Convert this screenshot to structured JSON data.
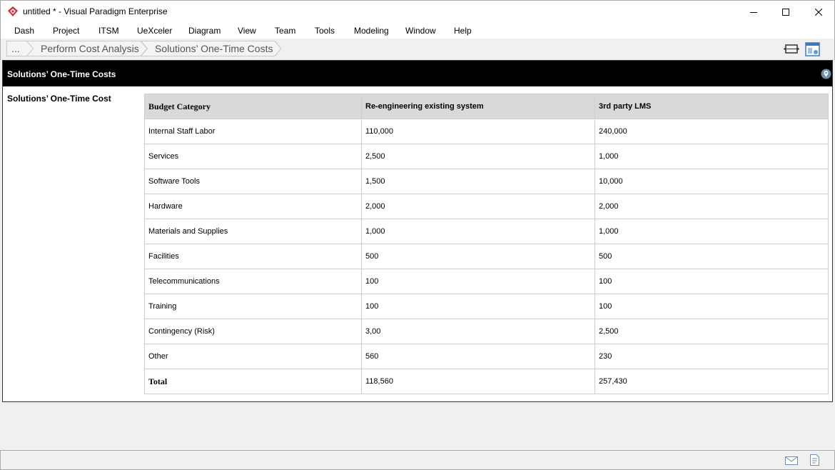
{
  "window": {
    "title": "untitled * - Visual Paradigm Enterprise",
    "app_icon": "visual-paradigm-logo",
    "controls": [
      "minimize-icon",
      "maximize-icon",
      "close-icon"
    ]
  },
  "menu": {
    "items": [
      "Dash",
      "Project",
      "ITSM",
      "UeXceler",
      "Diagram",
      "View",
      "Team",
      "Tools",
      "Modeling",
      "Window",
      "Help"
    ]
  },
  "breadcrumb": {
    "items": [
      "...",
      "Perform Cost Analysis",
      "Solutions’ One-Time Costs"
    ]
  },
  "toolbar": {
    "icons": [
      "fit-width-icon",
      "diagram-overview-icon"
    ]
  },
  "panel": {
    "title": "Solutions’ One-Time Costs",
    "pin_icon": "pin-icon",
    "field_label": "Solutions’ One-Time Cost"
  },
  "table": {
    "headers": [
      "Budget Category",
      "Re-engineering existing system",
      "3rd party LMS"
    ],
    "rows": [
      [
        "Internal Staff Labor",
        "110,000",
        "240,000"
      ],
      [
        "Services",
        "2,500",
        "1,000"
      ],
      [
        "Software Tools",
        "1,500",
        "10,000"
      ],
      [
        "Hardware",
        "2,000",
        "2,000"
      ],
      [
        "Materials and Supplies",
        "1,000",
        "1,000"
      ],
      [
        "Facilities",
        "500",
        "500"
      ],
      [
        "Telecommunications",
        "100",
        "100"
      ],
      [
        "Training",
        "100",
        "100"
      ],
      [
        "Contingency (Risk)",
        "3,00",
        "2,500"
      ],
      [
        "Other",
        "560",
        "230"
      ]
    ],
    "total": [
      "Total",
      "118,560",
      "257,430"
    ]
  },
  "statusbar": {
    "icons": [
      "mail-icon",
      "notes-icon"
    ]
  },
  "colors": {
    "panel_header_bg": "#000000",
    "table_header_bg": "#d9d9d9",
    "logo_red": "#d9262c"
  }
}
